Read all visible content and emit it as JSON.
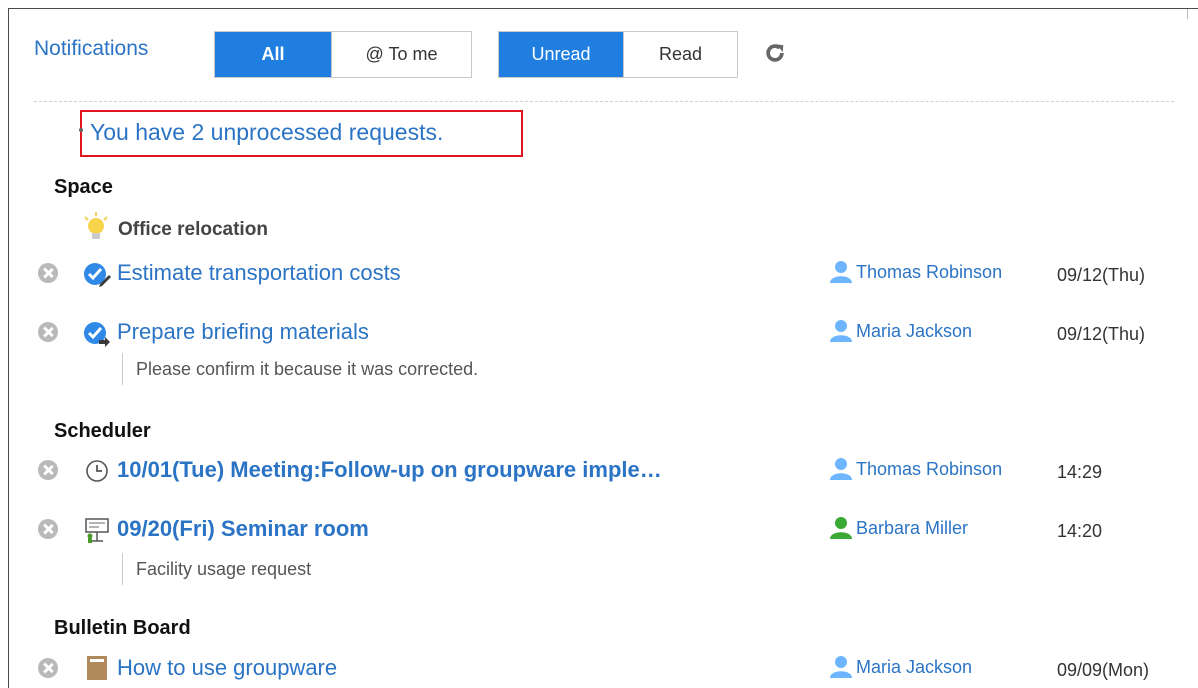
{
  "toolbar": {
    "title": "Notifications",
    "filter_all": "All",
    "filter_to_me": "@ To me",
    "filter_unread": "Unread",
    "filter_read": "Read"
  },
  "notice": {
    "text": "You have 2 unprocessed requests."
  },
  "colors": {
    "link": "#2b74c5",
    "active_button": "#1f7ee0",
    "highlight_border": "#e0141c",
    "close_button": "#b9b9b9"
  },
  "sections": {
    "space": {
      "title": "Space",
      "app_title": "Office relocation",
      "items": [
        {
          "icon": "todo-check-icon",
          "title": "Estimate transportation costs",
          "user": "Thomas Robinson",
          "date": "09/12(Thu)"
        },
        {
          "icon": "todo-forward-icon",
          "title": "Prepare briefing materials",
          "user": "Maria Jackson",
          "date": "09/12(Thu)",
          "comment": "Please confirm it because it was corrected."
        }
      ]
    },
    "scheduler": {
      "title": "Scheduler",
      "items": [
        {
          "icon": "clock-icon",
          "title": "10/01(Tue) Meeting:Follow-up on groupware imple…",
          "user": "Thomas Robinson",
          "date": "14:29"
        },
        {
          "icon": "facility-icon",
          "title": "09/20(Fri) Seminar room",
          "user": "Barbara Miller",
          "date": "14:20",
          "comment": "Facility usage request"
        }
      ]
    },
    "bulletin": {
      "title": "Bulletin Board",
      "items": [
        {
          "icon": "bulletin-icon",
          "title": "How to use groupware",
          "user": "Maria Jackson",
          "date": "09/09(Mon)"
        }
      ]
    }
  }
}
